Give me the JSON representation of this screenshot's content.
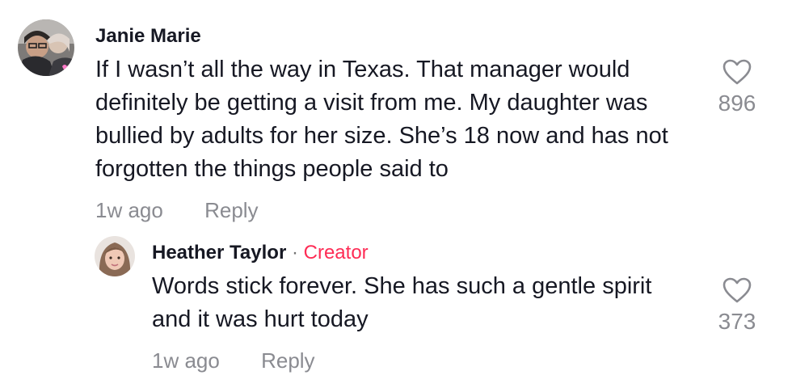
{
  "comments": [
    {
      "username": "Janie Marie",
      "text": "If I wasn’t all the way in Texas. That manager would definitely be getting a visit from me. My daughter was bullied by adults for her size. She’s 18 now and has not forgotten the things people said to",
      "time": "1w ago",
      "reply_label": "Reply",
      "likes": "896",
      "avatar_icon": "user-avatar-photo"
    },
    {
      "username": "Heather Taylor",
      "separator": "·",
      "badge": "Creator",
      "text": "Words stick forever. She has such a gentle spirit and it was hurt today",
      "time": "1w ago",
      "reply_label": "Reply",
      "likes": "373",
      "avatar_icon": "user-avatar-photo"
    }
  ],
  "colors": {
    "text": "#161823",
    "muted": "#8a8b91",
    "creator": "#fe2c55"
  }
}
